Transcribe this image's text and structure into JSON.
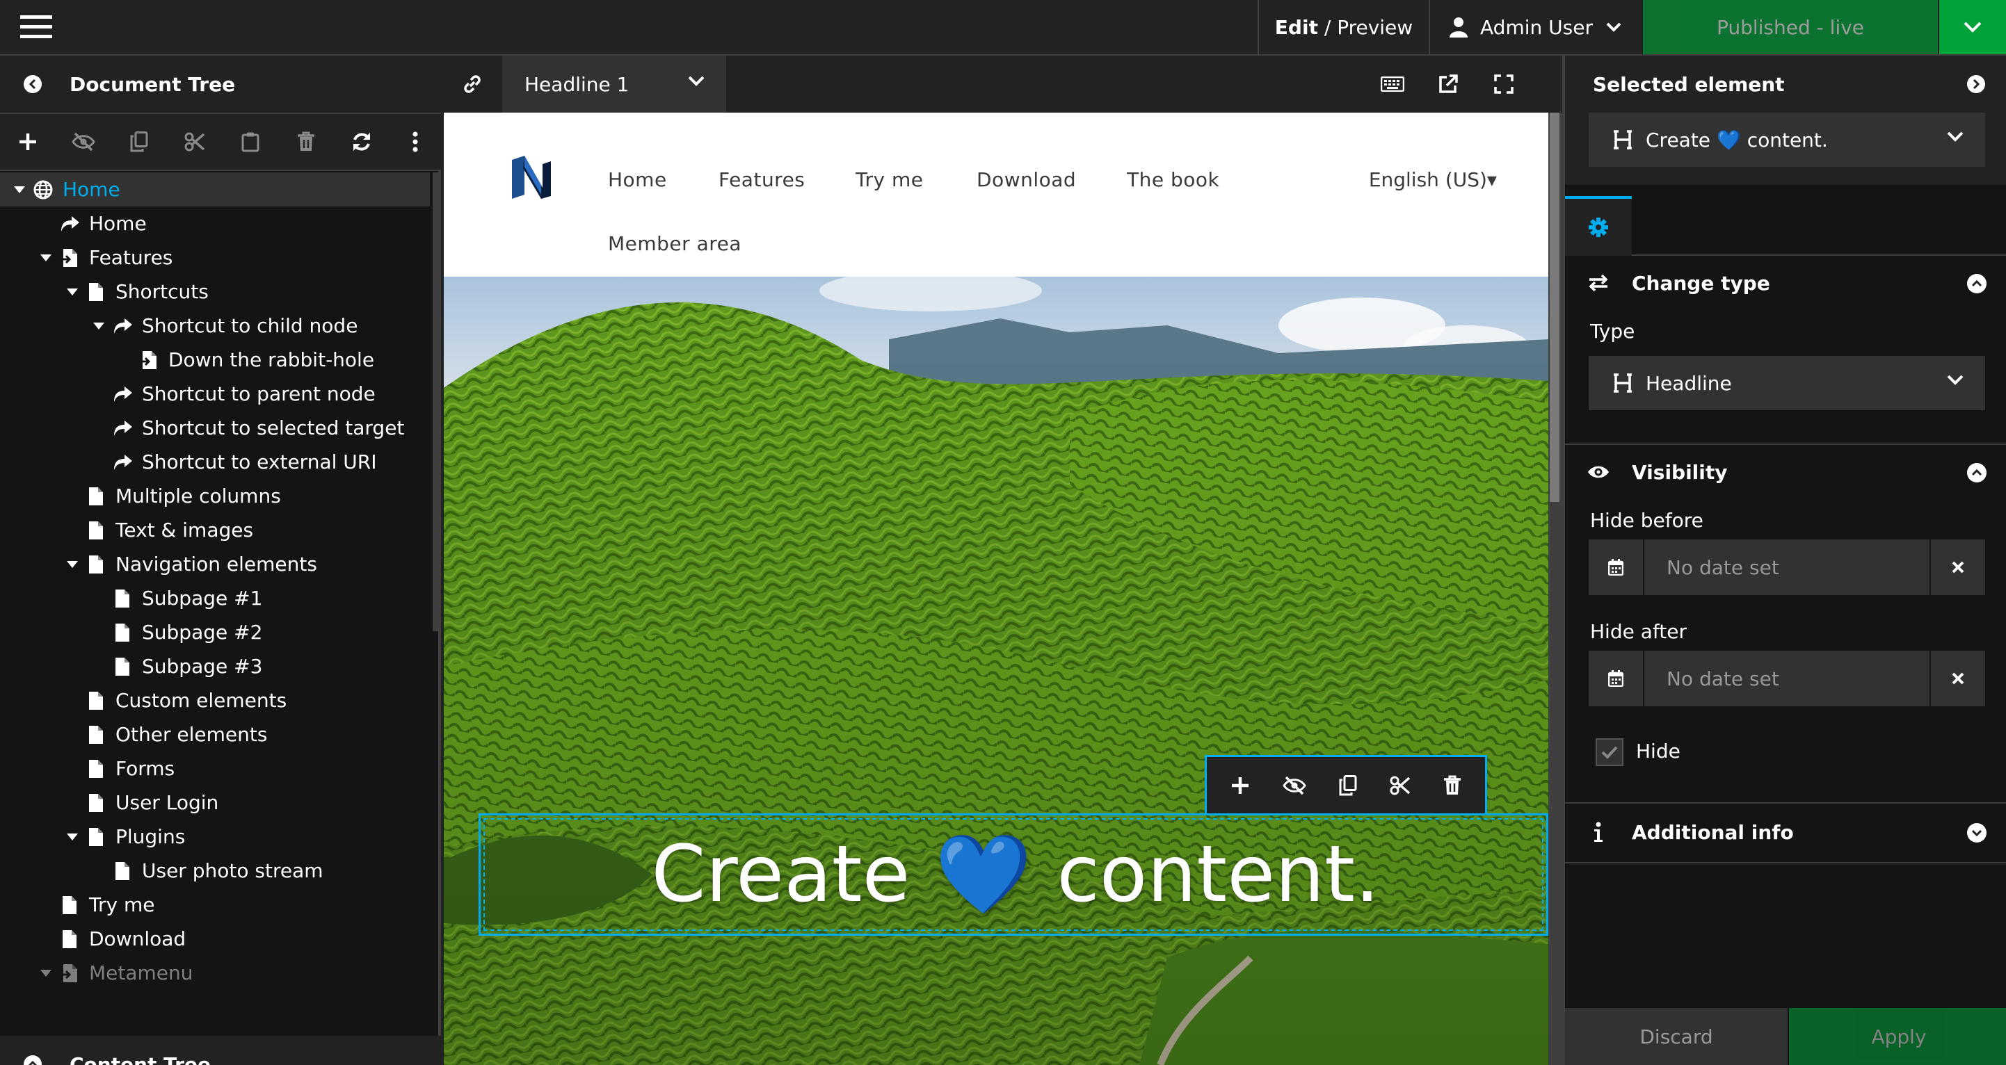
{
  "topbar": {
    "edit_label": "Edit",
    "preview_label": "Preview",
    "user_name": "Admin User",
    "publish_label": "Published - live"
  },
  "left_panel": {
    "document_tree_title": "Document Tree",
    "content_tree_title": "Content Tree",
    "toolbar_icons": [
      "plus-icon",
      "eye-slash-icon",
      "copy-icon",
      "cut-icon",
      "paste-icon",
      "trash-icon",
      "refresh-icon",
      "more-vertical-icon"
    ],
    "tree": [
      {
        "label": "Home",
        "depth": 0,
        "icon": "globe-icon",
        "caret": "expanded",
        "selected": true
      },
      {
        "label": "Home",
        "depth": 1,
        "icon": "shortcut-icon",
        "caret": "none"
      },
      {
        "label": "Features",
        "depth": 1,
        "icon": "page-arrow-icon",
        "caret": "expanded"
      },
      {
        "label": "Shortcuts",
        "depth": 2,
        "icon": "page-icon",
        "caret": "expanded"
      },
      {
        "label": "Shortcut to child node",
        "depth": 3,
        "icon": "shortcut-icon",
        "caret": "expanded"
      },
      {
        "label": "Down the rabbit-hole",
        "depth": 4,
        "icon": "page-arrow-icon",
        "caret": "none"
      },
      {
        "label": "Shortcut to parent node",
        "depth": 3,
        "icon": "shortcut-icon",
        "caret": "none"
      },
      {
        "label": "Shortcut to selected target",
        "depth": 3,
        "icon": "shortcut-icon",
        "caret": "none"
      },
      {
        "label": "Shortcut to external URI",
        "depth": 3,
        "icon": "shortcut-icon",
        "caret": "none"
      },
      {
        "label": "Multiple columns",
        "depth": 2,
        "icon": "page-icon",
        "caret": "none"
      },
      {
        "label": "Text & images",
        "depth": 2,
        "icon": "page-icon",
        "caret": "none"
      },
      {
        "label": "Navigation elements",
        "depth": 2,
        "icon": "page-icon",
        "caret": "expanded"
      },
      {
        "label": "Subpage #1",
        "depth": 3,
        "icon": "page-icon",
        "caret": "none"
      },
      {
        "label": "Subpage #2",
        "depth": 3,
        "icon": "page-icon",
        "caret": "none"
      },
      {
        "label": "Subpage #3",
        "depth": 3,
        "icon": "page-icon",
        "caret": "none"
      },
      {
        "label": "Custom elements",
        "depth": 2,
        "icon": "page-icon",
        "caret": "none"
      },
      {
        "label": "Other elements",
        "depth": 2,
        "icon": "page-icon",
        "caret": "none"
      },
      {
        "label": "Forms",
        "depth": 2,
        "icon": "page-icon",
        "caret": "none"
      },
      {
        "label": "User Login",
        "depth": 2,
        "icon": "page-icon",
        "caret": "none"
      },
      {
        "label": "Plugins",
        "depth": 2,
        "icon": "page-icon",
        "caret": "expanded"
      },
      {
        "label": "User photo stream",
        "depth": 3,
        "icon": "page-icon",
        "caret": "none"
      },
      {
        "label": "Try me",
        "depth": 1,
        "icon": "page-icon",
        "caret": "none"
      },
      {
        "label": "Download",
        "depth": 1,
        "icon": "page-icon",
        "caret": "none"
      },
      {
        "label": "Metamenu",
        "depth": 1,
        "icon": "page-arrow-icon",
        "caret": "expanded",
        "dim": true
      }
    ]
  },
  "center": {
    "style_select_value": "Headline 1",
    "site": {
      "nav": [
        "Home",
        "Features",
        "Try me",
        "Download",
        "The book",
        "Member area"
      ],
      "language": "English (US)▾",
      "headline": "Create 💙 content."
    },
    "inline_toolbar_icons": [
      "plus-icon",
      "eye-slash-icon",
      "copy-icon",
      "cut-icon",
      "trash-icon"
    ]
  },
  "right_panel": {
    "title": "Selected element",
    "element_select_value": "Create 💙 content.",
    "sections": {
      "change_type": "Change type",
      "type_label": "Type",
      "type_value": "Headline",
      "visibility": "Visibility",
      "hide_before_label": "Hide before",
      "hide_before_placeholder": "No date set",
      "hide_after_label": "Hide after",
      "hide_after_placeholder": "No date set",
      "hide_label": "Hide",
      "additional_info": "Additional info"
    },
    "discard_label": "Discard",
    "apply_label": "Apply"
  },
  "colors": {
    "accent": "#00adee",
    "publish_green": "#00a338",
    "panel_bg": "#141414",
    "bar_bg": "#222222"
  }
}
